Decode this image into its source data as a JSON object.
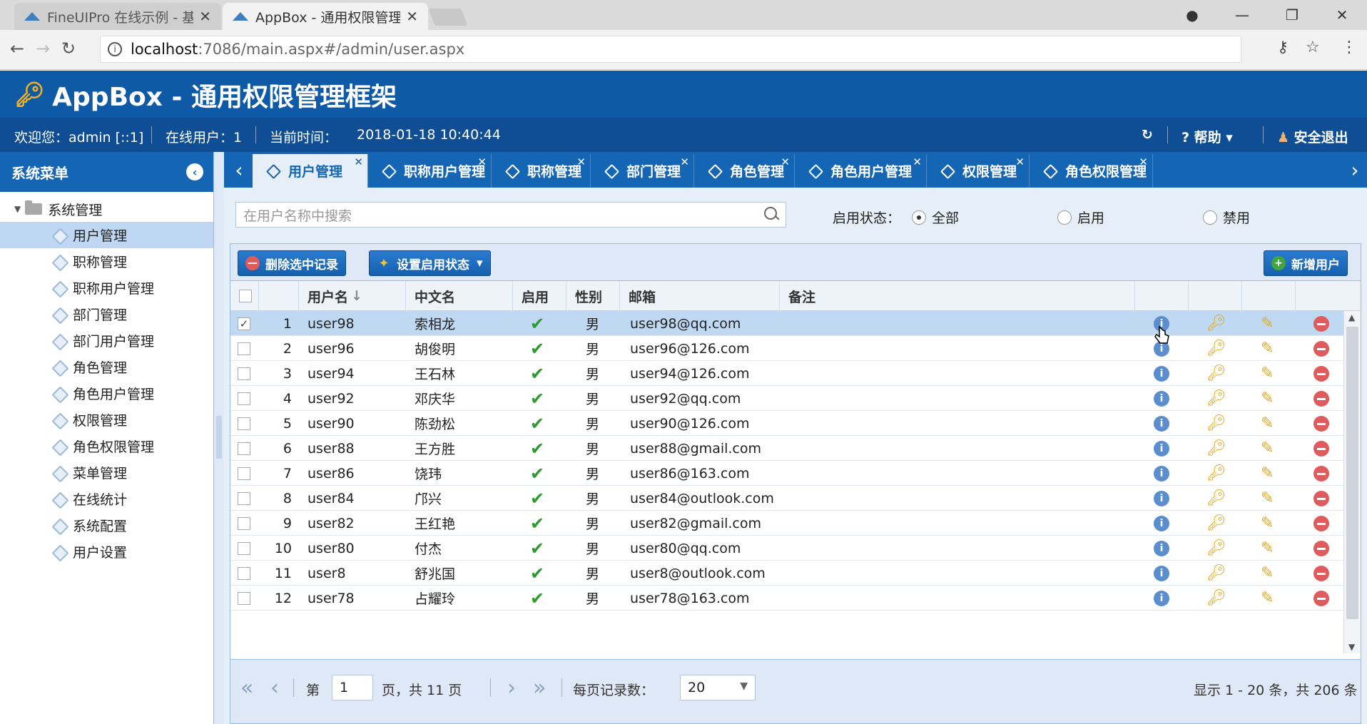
{
  "browser": {
    "tabs": [
      {
        "title": "FineUIPro 在线示例 - 基"
      },
      {
        "title": "AppBox - 通用权限管理"
      }
    ],
    "url_host": "localhost",
    "url_path": ":7086/main.aspx#/admin/user.aspx"
  },
  "app": {
    "title": "AppBox - 通用权限管理框架",
    "welcome": "欢迎您：admin [::1]",
    "online": "在线用户：1",
    "time_label": "当前时间：",
    "time_value": "2018-01-18 10:40:44",
    "help": "帮助",
    "logout": "安全退出"
  },
  "sidebar": {
    "title": "系统菜单",
    "root": "系统管理",
    "items": [
      "用户管理",
      "职称管理",
      "职称用户管理",
      "部门管理",
      "部门用户管理",
      "角色管理",
      "角色用户管理",
      "权限管理",
      "角色权限管理",
      "菜单管理",
      "在线统计",
      "系统配置",
      "用户设置"
    ]
  },
  "tabs": [
    "用户管理",
    "职称用户管理",
    "职称管理",
    "部门管理",
    "角色管理",
    "角色用户管理",
    "权限管理",
    "角色权限管理"
  ],
  "filter": {
    "search_placeholder": "在用户名称中搜索",
    "label": "启用状态：",
    "options": [
      "全部",
      "启用",
      "禁用"
    ],
    "selected": "全部"
  },
  "toolbar": {
    "delete": "删除选中记录",
    "set_status": "设置启用状态",
    "add_user": "新增用户"
  },
  "grid": {
    "columns": [
      "用户名",
      "中文名",
      "启用",
      "性别",
      "邮箱",
      "备注"
    ],
    "sort_arrow": "↓",
    "rows": [
      {
        "no": "1",
        "user": "user98",
        "name": "索相龙",
        "gender": "男",
        "email": "user98@qq.com",
        "checked": true
      },
      {
        "no": "2",
        "user": "user96",
        "name": "胡俊明",
        "gender": "男",
        "email": "user96@126.com",
        "checked": false
      },
      {
        "no": "3",
        "user": "user94",
        "name": "王石林",
        "gender": "男",
        "email": "user94@126.com",
        "checked": false
      },
      {
        "no": "4",
        "user": "user92",
        "name": "邓庆华",
        "gender": "男",
        "email": "user92@qq.com",
        "checked": false
      },
      {
        "no": "5",
        "user": "user90",
        "name": "陈劲松",
        "gender": "男",
        "email": "user90@126.com",
        "checked": false
      },
      {
        "no": "6",
        "user": "user88",
        "name": "王方胜",
        "gender": "男",
        "email": "user88@gmail.com",
        "checked": false
      },
      {
        "no": "7",
        "user": "user86",
        "name": "饶玮",
        "gender": "男",
        "email": "user86@163.com",
        "checked": false
      },
      {
        "no": "8",
        "user": "user84",
        "name": "邝兴",
        "gender": "男",
        "email": "user84@outlook.com",
        "checked": false
      },
      {
        "no": "9",
        "user": "user82",
        "name": "王红艳",
        "gender": "男",
        "email": "user82@gmail.com",
        "checked": false
      },
      {
        "no": "10",
        "user": "user80",
        "name": "付杰",
        "gender": "男",
        "email": "user80@qq.com",
        "checked": false
      },
      {
        "no": "11",
        "user": "user8",
        "name": "舒兆国",
        "gender": "男",
        "email": "user8@outlook.com",
        "checked": false
      },
      {
        "no": "12",
        "user": "user78",
        "name": "占耀玲",
        "gender": "男",
        "email": "user78@163.com",
        "checked": false
      }
    ]
  },
  "pager": {
    "page_prefix": "第",
    "page_value": "1",
    "page_suffix": "页，共 11 页",
    "page_size_label": "每页记录数：",
    "page_size": "20",
    "summary": "显示 1 - 20 条，共 206 条"
  },
  "colors": {
    "header": "#0f5aa6",
    "accent": "#1565b5",
    "selected_row": "#c0d9f3"
  }
}
